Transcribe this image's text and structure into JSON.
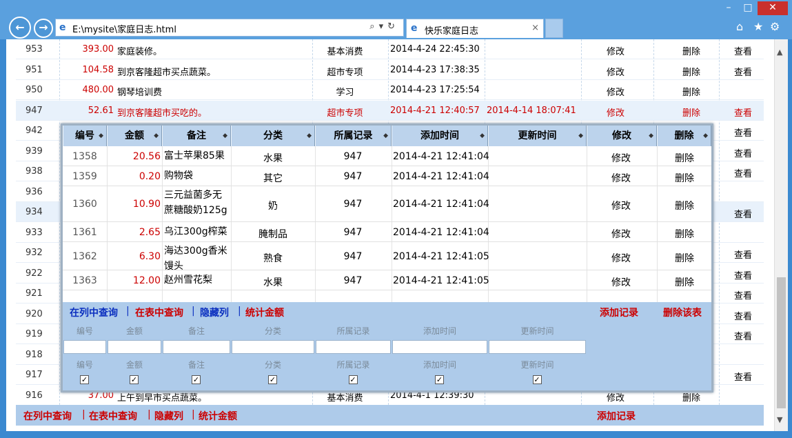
{
  "browser": {
    "url": "E:\\mysite\\家庭日志.html",
    "tab_title": "快乐家庭日志",
    "minimize": "–",
    "maximize": "□",
    "close": "✕"
  },
  "background_rows": [
    {
      "id": "953",
      "amount": "393.00",
      "note": "家庭装修。",
      "category": "基本消费",
      "added": "2014-4-24 22:45:30",
      "updated": "",
      "edit": "修改",
      "delete": "删除",
      "view": "查看",
      "highlight": false,
      "red": false,
      "dim": false
    },
    {
      "id": "951",
      "amount": "104.58",
      "note": "到京客隆超市买点蔬菜。",
      "category": "超市专项",
      "added": "2014-4-23 17:38:35",
      "updated": "",
      "edit": "修改",
      "delete": "删除",
      "view": "查看",
      "highlight": false,
      "red": false,
      "dim": false
    },
    {
      "id": "950",
      "amount": "480.00",
      "note": "钢琴培训费",
      "category": "学习",
      "added": "2014-4-23 17:25:54",
      "updated": "",
      "edit": "修改",
      "delete": "删除",
      "view": "",
      "highlight": false,
      "red": false,
      "dim": false
    },
    {
      "id": "947",
      "amount": "52.61",
      "note": "到京客隆超市买吃的。",
      "category": "超市专项",
      "added": "2014-4-21 12:40:57",
      "updated": "2014-4-14 18:07:41",
      "edit": "修改",
      "delete": "删除",
      "view": "查看",
      "highlight": true,
      "red": true,
      "dim": false
    },
    {
      "id": "942",
      "amount": "",
      "note": "",
      "category": "",
      "added": "",
      "updated": "",
      "edit": "",
      "delete": "",
      "view": "查看",
      "highlight": false,
      "red": false,
      "dim": false
    },
    {
      "id": "939",
      "amount": "",
      "note": "",
      "category": "",
      "added": "",
      "updated": "",
      "edit": "",
      "delete": "",
      "view": "查看",
      "highlight": false,
      "red": false,
      "dim": false
    },
    {
      "id": "938",
      "amount": "",
      "note": "",
      "category": "",
      "added": "",
      "updated": "",
      "edit": "",
      "delete": "",
      "view": "查看",
      "highlight": false,
      "red": false,
      "dim": false
    },
    {
      "id": "936",
      "amount": "",
      "note": "",
      "category": "",
      "added": "",
      "updated": "",
      "edit": "",
      "delete": "",
      "view": "",
      "highlight": false,
      "red": false,
      "dim": false
    },
    {
      "id": "934",
      "amount": "",
      "note": "",
      "category": "",
      "added": "",
      "updated": "",
      "edit": "",
      "delete": "",
      "view": "查看",
      "highlight": true,
      "red": false,
      "dim": false
    },
    {
      "id": "933",
      "amount": "",
      "note": "",
      "category": "",
      "added": "",
      "updated": "",
      "edit": "",
      "delete": "",
      "view": "",
      "highlight": false,
      "red": false,
      "dim": false
    },
    {
      "id": "932",
      "amount": "",
      "note": "",
      "category": "",
      "added": "",
      "updated": "",
      "edit": "",
      "delete": "",
      "view": "查看",
      "highlight": false,
      "red": false,
      "dim": false
    },
    {
      "id": "922",
      "amount": "",
      "note": "",
      "category": "",
      "added": "",
      "updated": "",
      "edit": "",
      "delete": "",
      "view": "查看",
      "highlight": false,
      "red": false,
      "dim": false
    },
    {
      "id": "921",
      "amount": "",
      "note": "",
      "category": "",
      "added": "",
      "updated": "",
      "edit": "",
      "delete": "",
      "view": "查看",
      "highlight": false,
      "red": false,
      "dim": false
    },
    {
      "id": "920",
      "amount": "",
      "note": "",
      "category": "",
      "added": "",
      "updated": "",
      "edit": "",
      "delete": "",
      "view": "查看",
      "highlight": false,
      "red": false,
      "dim": false
    },
    {
      "id": "919",
      "amount": "",
      "note": "",
      "category": "",
      "added": "",
      "updated": "",
      "edit": "",
      "delete": "",
      "view": "查看",
      "highlight": false,
      "red": false,
      "dim": false
    },
    {
      "id": "918",
      "amount": "",
      "note": "",
      "category": "",
      "added": "",
      "updated": "",
      "edit": "",
      "delete": "",
      "view": "",
      "highlight": false,
      "red": false,
      "dim": false
    },
    {
      "id": "917",
      "amount": "",
      "note": "",
      "category": "",
      "added": "",
      "updated": "",
      "edit": "",
      "delete": "",
      "view": "查看",
      "highlight": false,
      "red": false,
      "dim": false
    },
    {
      "id": "916",
      "amount": "37.00",
      "note": "上午到早市买点蔬菜。",
      "category": "基本消费",
      "added": "2014-4-1 12:39:30",
      "updated": "",
      "edit": "修改",
      "delete": "删除",
      "view": "",
      "highlight": false,
      "red": false,
      "dim": false
    }
  ],
  "bottom_toolbar": {
    "query_column": "在列中查询",
    "query_table": "在表中查询",
    "hide_column": "隐藏列",
    "stat_amount": "统计金额",
    "add_record": "添加记录",
    "separator": "|"
  },
  "detail_table": {
    "headers": [
      "编号",
      "金额",
      "备注",
      "分类",
      "所属记录",
      "添加时间",
      "更新时间",
      "修改",
      "删除"
    ],
    "rows": [
      {
        "id": "1358",
        "amount": "20.56",
        "note": "富士苹果85果",
        "category": "水果",
        "record": "947",
        "added": "2014-4-21 12:41:04",
        "updated": "",
        "edit": "修改",
        "delete": "删除"
      },
      {
        "id": "1359",
        "amount": "0.20",
        "note": "购物袋",
        "category": "其它",
        "record": "947",
        "added": "2014-4-21 12:41:04",
        "updated": "",
        "edit": "修改",
        "delete": "删除"
      },
      {
        "id": "1360",
        "amount": "10.90",
        "note": "三元益菌多无蔗糖酸奶125g",
        "category": "奶",
        "record": "947",
        "added": "2014-4-21 12:41:04",
        "updated": "",
        "edit": "修改",
        "delete": "删除"
      },
      {
        "id": "1361",
        "amount": "2.65",
        "note": "乌江300g榨菜",
        "category": "腌制品",
        "record": "947",
        "added": "2014-4-21 12:41:04",
        "updated": "",
        "edit": "修改",
        "delete": "删除"
      },
      {
        "id": "1362",
        "amount": "6.30",
        "note": "海达300g香米馒头",
        "category": "熟食",
        "record": "947",
        "added": "2014-4-21 12:41:05",
        "updated": "",
        "edit": "修改",
        "delete": "删除"
      },
      {
        "id": "1363",
        "amount": "12.00",
        "note": "赵州雪花梨",
        "category": "水果",
        "record": "947",
        "added": "2014-4-21 12:41:05",
        "updated": "",
        "edit": "修改",
        "delete": "删除"
      }
    ],
    "toolbar": {
      "query_column": "在列中查询",
      "query_table": "在表中查询",
      "hide_column": "隐藏列",
      "stat_amount": "统计金额",
      "add_record": "添加记录",
      "delete_table": "删除该表",
      "separator": "|"
    },
    "filter_labels": [
      "编号",
      "金额",
      "备注",
      "分类",
      "所属记录",
      "添加时间",
      "更新时间"
    ],
    "checkbox_labels": [
      "编号",
      "金额",
      "备注",
      "分类",
      "所属记录",
      "添加时间",
      "更新时间"
    ],
    "checkbox_mark": "✓"
  },
  "colors": {
    "accent_red": "#cc0000",
    "link_blue": "#0b2fbf",
    "header_bg": "#bcd3ec",
    "toolbar_bg": "#aecbea"
  }
}
